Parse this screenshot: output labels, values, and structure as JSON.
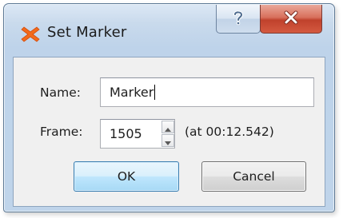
{
  "window": {
    "title": "Set Marker",
    "icon": "marker-x-icon",
    "title_buttons": {
      "help_icon": "question-mark-icon",
      "close_icon": "close-x-icon"
    }
  },
  "form": {
    "name_label": "Name:",
    "name_value": "Marker",
    "frame_label": "Frame:",
    "frame_value": "1505",
    "frame_time": "(at 00:12.542)"
  },
  "buttons": {
    "ok_label": "OK",
    "cancel_label": "Cancel"
  },
  "colors": {
    "icon_orange": "#f26a1b",
    "close_red": "#c0412c",
    "ok_focus_blue": "#3c7fb1"
  }
}
